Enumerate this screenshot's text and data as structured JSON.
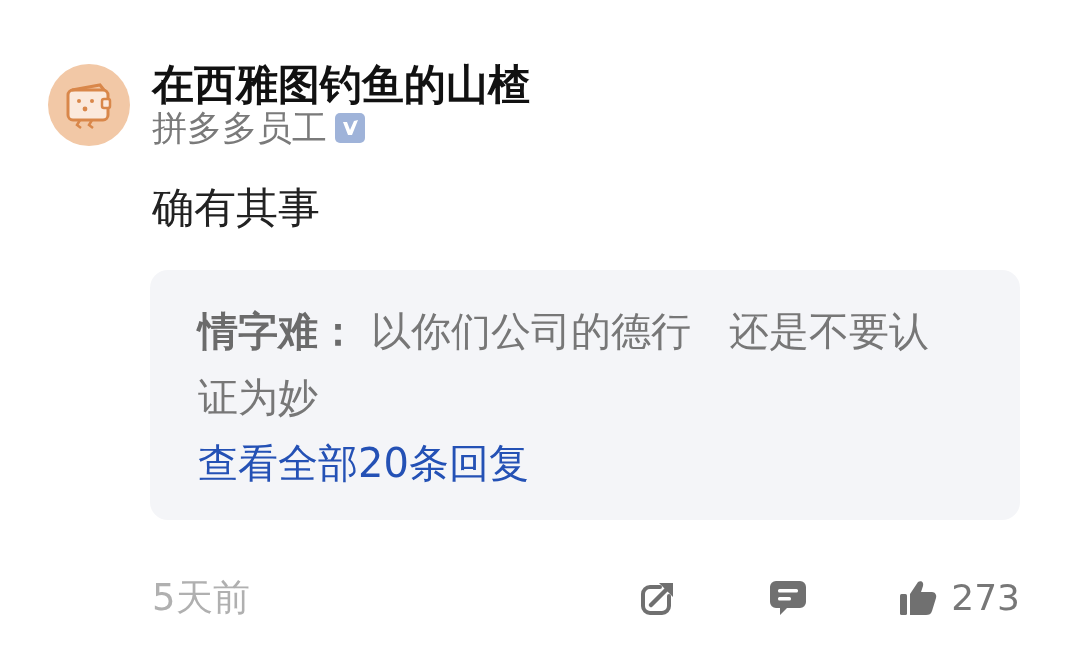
{
  "comment": {
    "author": {
      "name": "在西雅图钓鱼的山楂",
      "title": "拼多多员工",
      "verified": true
    },
    "text": "确有其事",
    "reply_preview": {
      "replies": [
        {
          "text": "**情字难：** 以你们公司的德行   还是不要认证为妙"
        }
      ],
      "view_all": "查看全部20条回复"
    },
    "footer": {
      "time": "5天前",
      "likes": "273"
    }
  }
}
